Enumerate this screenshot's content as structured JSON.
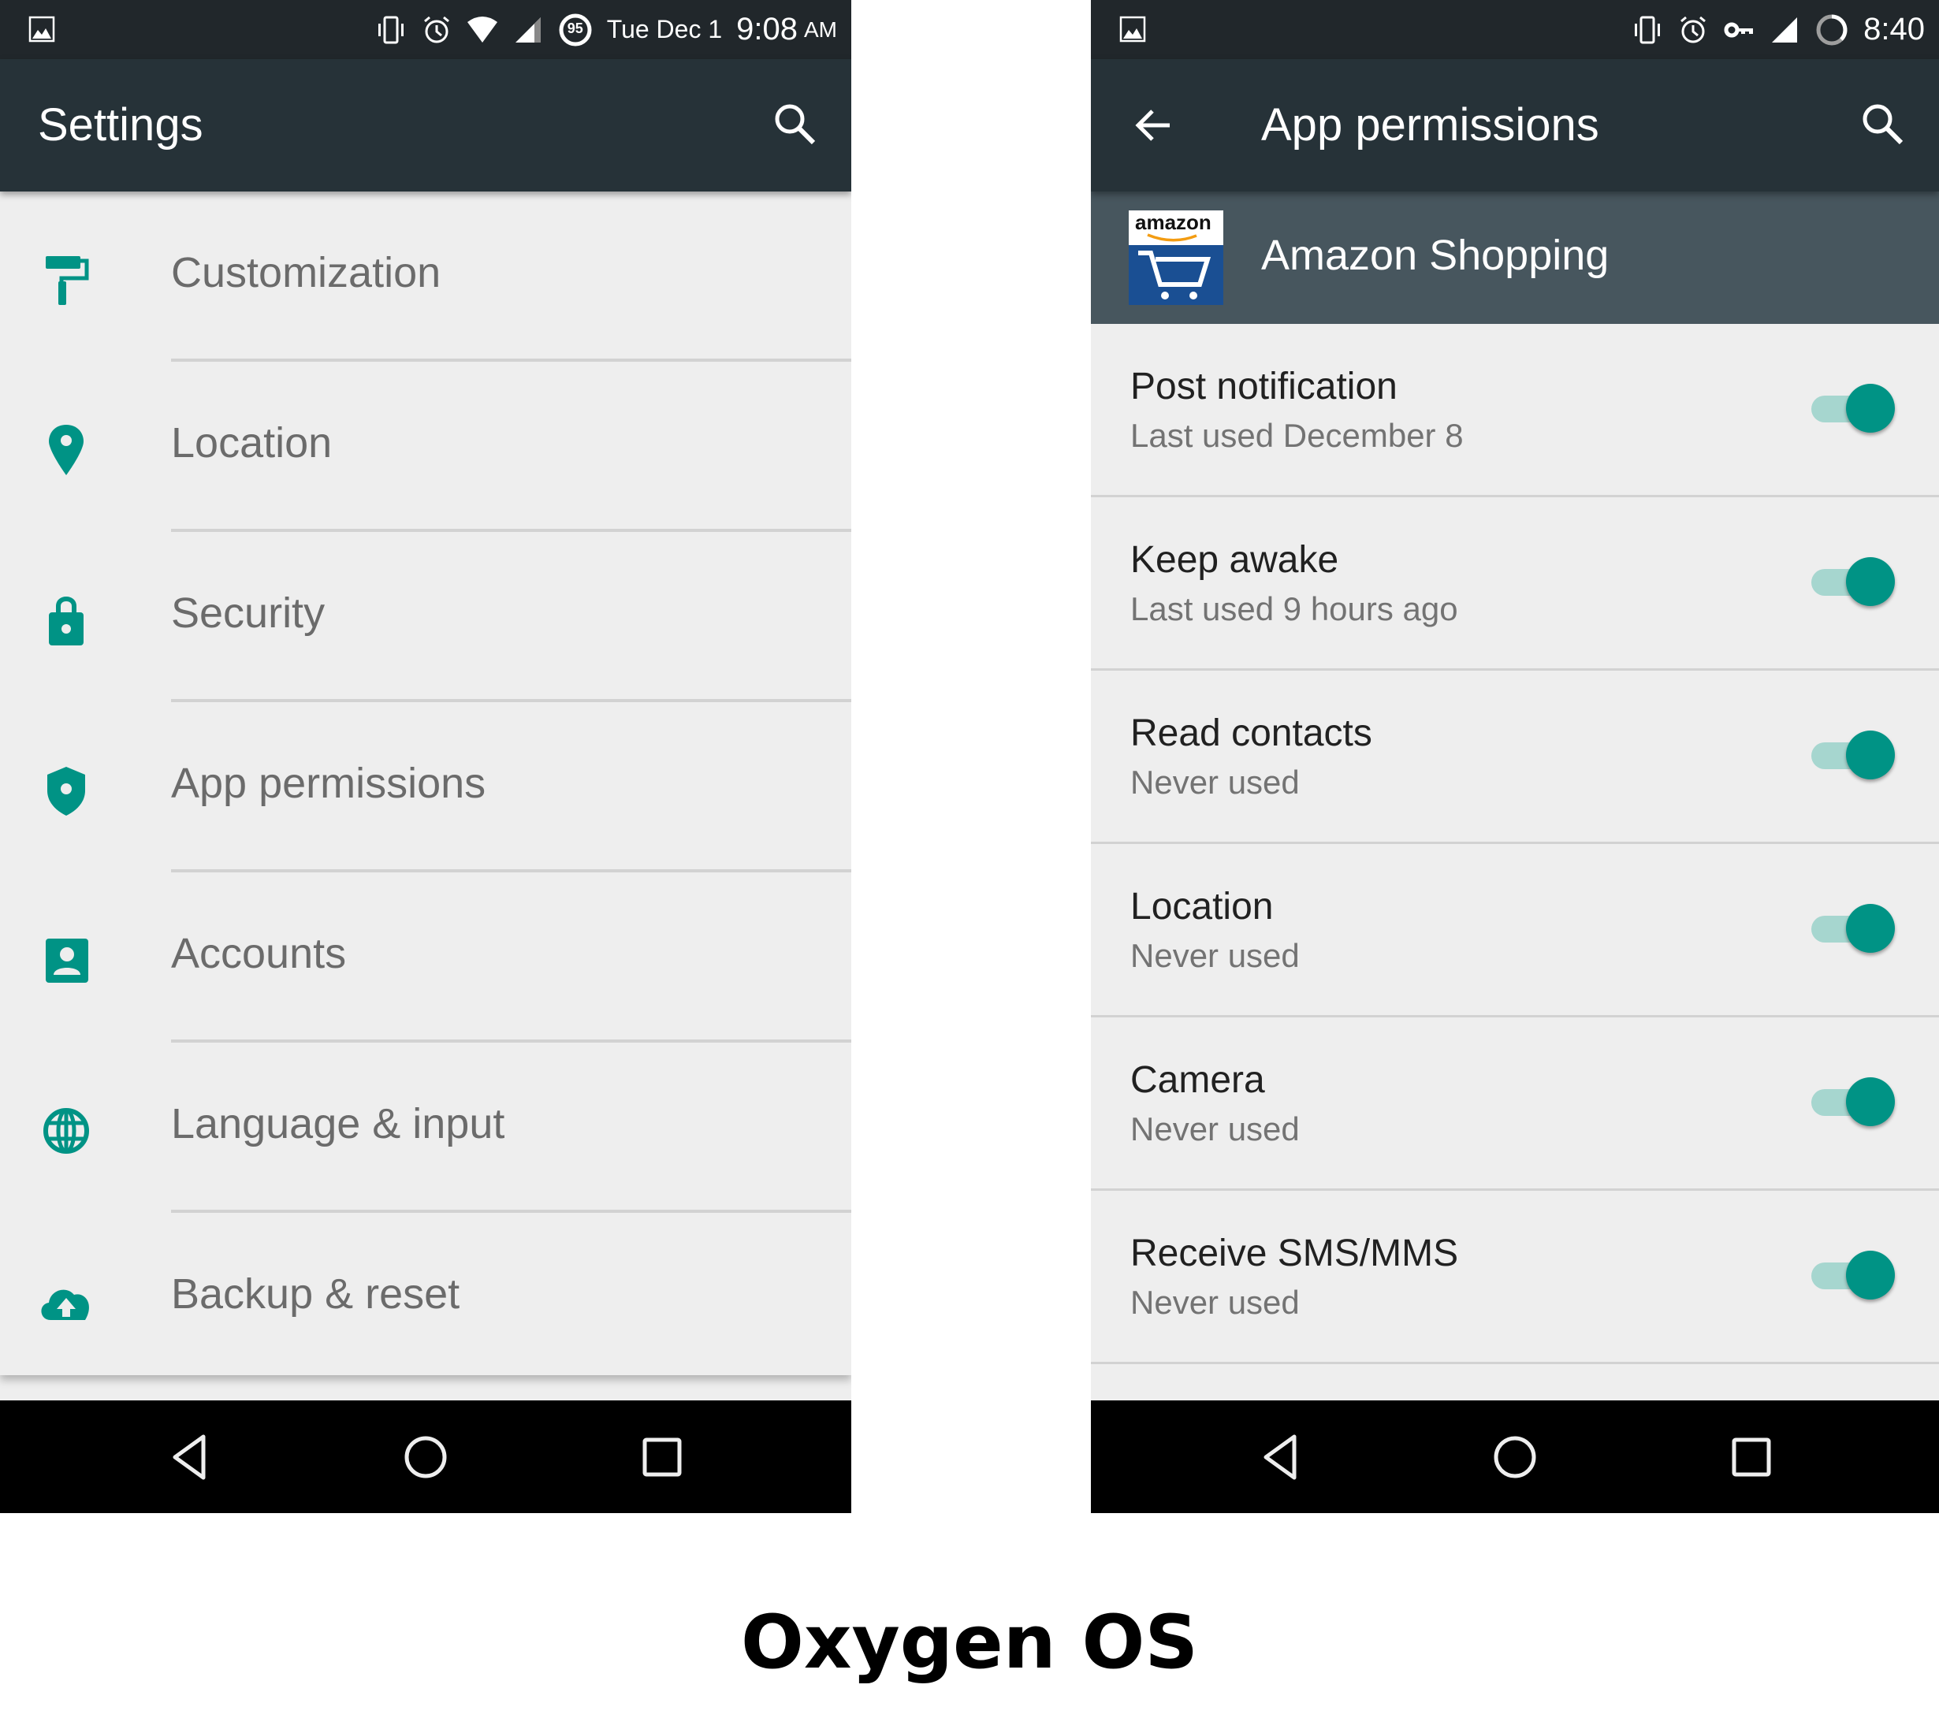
{
  "colors": {
    "accent": "#009385",
    "statusbar_bg": "#21272b",
    "toolbar_bg": "#263238",
    "app_header_bg": "#47565e",
    "list_bg": "#eeeeee",
    "navbar_bg": "#000000"
  },
  "left_screen": {
    "status_bar": {
      "icons": [
        "image-notification-icon",
        "vibrate-icon",
        "alarm-icon",
        "wifi-icon",
        "cell-signal-icon",
        "battery-circle-icon"
      ],
      "battery_level": "95",
      "date": "Tue Dec 1",
      "time": "9:08",
      "ampm": "AM"
    },
    "toolbar": {
      "title": "Settings",
      "search_icon": "search-icon"
    },
    "settings_items": [
      {
        "label": "Customization",
        "icon": "paint-roller-icon"
      },
      {
        "label": "Location",
        "icon": "location-pin-icon"
      },
      {
        "label": "Security",
        "icon": "lock-icon"
      },
      {
        "label": "App permissions",
        "icon": "shield-icon"
      },
      {
        "label": "Accounts",
        "icon": "account-box-icon"
      },
      {
        "label": "Language & input",
        "icon": "globe-icon"
      },
      {
        "label": "Backup & reset",
        "icon": "cloud-upload-icon"
      }
    ],
    "nav_bar": [
      "back-icon",
      "home-icon",
      "recents-icon"
    ]
  },
  "right_screen": {
    "status_bar": {
      "icons": [
        "image-notification-icon",
        "vibrate-icon",
        "alarm-icon",
        "vpn-key-icon",
        "cell-signal-icon",
        "battery-circle-icon"
      ],
      "time": "8:40"
    },
    "toolbar": {
      "title": "App permissions",
      "back_icon": "arrow-back-icon",
      "search_icon": "search-icon"
    },
    "app": {
      "name": "Amazon Shopping",
      "logo_text": "amazon"
    },
    "permissions": [
      {
        "title": "Post notification",
        "subtitle": "Last used December 8",
        "enabled": true
      },
      {
        "title": "Keep awake",
        "subtitle": "Last used 9 hours ago",
        "enabled": true
      },
      {
        "title": "Read contacts",
        "subtitle": "Never used",
        "enabled": true
      },
      {
        "title": "Location",
        "subtitle": "Never used",
        "enabled": true
      },
      {
        "title": "Camera",
        "subtitle": "Never used",
        "enabled": true
      },
      {
        "title": "Receive SMS/MMS",
        "subtitle": "Never used",
        "enabled": true
      }
    ],
    "nav_bar": [
      "back-icon",
      "home-icon",
      "recents-icon"
    ]
  },
  "caption": "Oxygen OS"
}
